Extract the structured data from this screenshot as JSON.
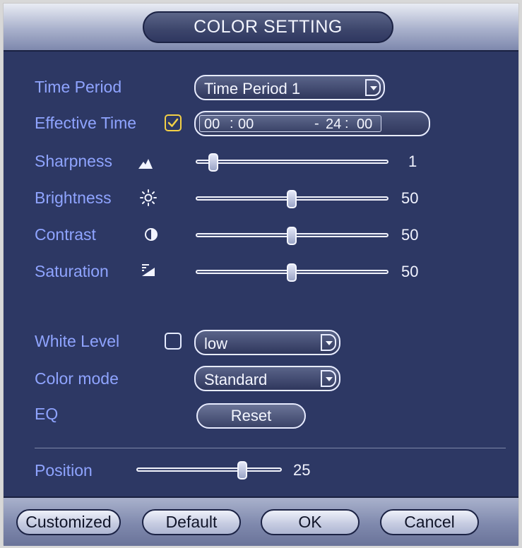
{
  "dialog": {
    "title": "COLOR SETTING"
  },
  "time_period": {
    "label": "Time Period",
    "selected": "Time Period 1"
  },
  "effective_time": {
    "label": "Effective Time",
    "checked": true,
    "start_hour": "00",
    "start_min": "00",
    "end_hour": "24",
    "end_min": "00"
  },
  "sharpness": {
    "label": "Sharpness",
    "value": "1",
    "icon": "sharpness-icon"
  },
  "brightness": {
    "label": "Brightness",
    "value": "50",
    "icon": "sun-icon"
  },
  "contrast": {
    "label": "Contrast",
    "value": "50",
    "icon": "half-circle-icon"
  },
  "saturation": {
    "label": "Saturation",
    "value": "50",
    "icon": "saturation-icon"
  },
  "white_level": {
    "label": "White Level",
    "checked": false,
    "selected": "low"
  },
  "color_mode": {
    "label": "Color mode",
    "selected": "Standard"
  },
  "eq": {
    "label": "EQ",
    "button": "Reset"
  },
  "position": {
    "label": "Position",
    "value": "25"
  },
  "footer": {
    "customized": "Customized",
    "default": "Default",
    "ok": "OK",
    "cancel": "Cancel"
  },
  "colors": {
    "label": "#8fa4ff",
    "background": "#2d3864",
    "check_accent": "#f3d046"
  }
}
